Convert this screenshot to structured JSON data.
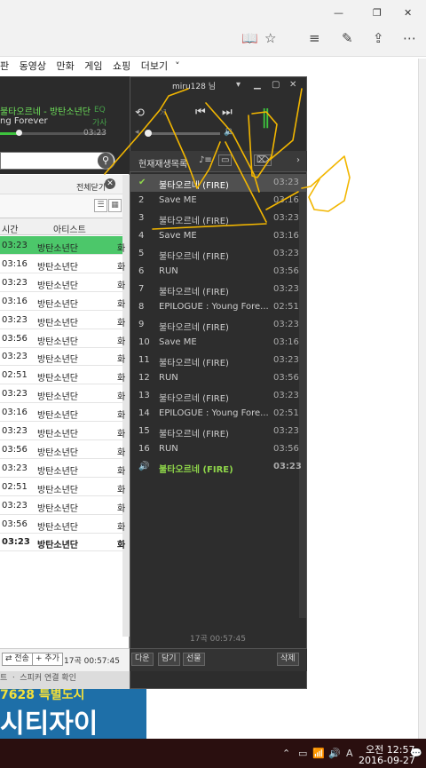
{
  "browser": {
    "window_controls": [
      "—",
      "❐",
      "✕"
    ],
    "toolbar_icons": [
      "reading-view",
      "favorite",
      "hub",
      "notes",
      "share",
      "more"
    ],
    "toolbar_glyphs": [
      "📖",
      "☆",
      "≡",
      "✎",
      "⇪",
      "⋯"
    ]
  },
  "site": {
    "nav": [
      "판",
      "동영상",
      "만화",
      "게임",
      "쇼핑",
      "더보기"
    ],
    "ad_line1": "7628 특별도시",
    "ad_line2": "시티자이"
  },
  "player": {
    "user": "miru128 님",
    "now_playing": {
      "title": "불타오르네 - 방탄소년단",
      "subtitle": "ng Forever",
      "time": "03:23",
      "eq": "EQ",
      "eq_sub": "가사"
    },
    "left_list": {
      "close_all": "전체닫기",
      "columns": {
        "time": "시간",
        "artist": "아티스트"
      },
      "rows": [
        {
          "time": "03:23",
          "artist": "방탄소년단",
          "x": "화",
          "selected": true
        },
        {
          "time": "03:16",
          "artist": "방탄소년단",
          "x": "화"
        },
        {
          "time": "03:23",
          "artist": "방탄소년단",
          "x": "화"
        },
        {
          "time": "03:16",
          "artist": "방탄소년단",
          "x": "화"
        },
        {
          "time": "03:23",
          "artist": "방탄소년단",
          "x": "화"
        },
        {
          "time": "03:56",
          "artist": "방탄소년단",
          "x": "화"
        },
        {
          "time": "03:23",
          "artist": "방탄소년단",
          "x": "화"
        },
        {
          "time": "02:51",
          "artist": "방탄소년단",
          "x": "화"
        },
        {
          "time": "03:23",
          "artist": "방탄소년단",
          "x": "화"
        },
        {
          "time": "03:16",
          "artist": "방탄소년단",
          "x": "화"
        },
        {
          "time": "03:23",
          "artist": "방탄소년단",
          "x": "화"
        },
        {
          "time": "03:56",
          "artist": "방탄소년단",
          "x": "화"
        },
        {
          "time": "03:23",
          "artist": "방탄소년단",
          "x": "화"
        },
        {
          "time": "02:51",
          "artist": "방탄소년단",
          "x": "화"
        },
        {
          "time": "03:23",
          "artist": "방탄소년단",
          "x": "화"
        },
        {
          "time": "03:56",
          "artist": "방탄소년단",
          "x": "화"
        },
        {
          "time": "03:23",
          "artist": "방탄소년단",
          "x": "화",
          "bold": true
        }
      ],
      "footer": {
        "transfer": "전송",
        "add": "추가",
        "summary": "17곡 00:57:45"
      },
      "status": "트 ㆍ 스피커 연결 확인"
    },
    "playlist": {
      "tab": "현재재생목록",
      "rows": [
        {
          "num": "✔",
          "title": "불타오르네 (FIRE)",
          "dur": "03:23",
          "selected": true
        },
        {
          "num": "2",
          "title": "Save ME",
          "dur": "03:16"
        },
        {
          "num": "3",
          "title": "불타오르네 (FIRE)",
          "dur": "03:23"
        },
        {
          "num": "4",
          "title": "Save ME",
          "dur": "03:16"
        },
        {
          "num": "5",
          "title": "불타오르네 (FIRE)",
          "dur": "03:23"
        },
        {
          "num": "6",
          "title": "RUN",
          "dur": "03:56"
        },
        {
          "num": "7",
          "title": "불타오르네 (FIRE)",
          "dur": "03:23"
        },
        {
          "num": "8",
          "title": "EPILOGUE : Young Fore...",
          "dur": "02:51"
        },
        {
          "num": "9",
          "title": "불타오르네 (FIRE)",
          "dur": "03:23"
        },
        {
          "num": "10",
          "title": "Save ME",
          "dur": "03:16"
        },
        {
          "num": "11",
          "title": "불타오르네 (FIRE)",
          "dur": "03:23"
        },
        {
          "num": "12",
          "title": "RUN",
          "dur": "03:56"
        },
        {
          "num": "13",
          "title": "불타오르네 (FIRE)",
          "dur": "03:23"
        },
        {
          "num": "14",
          "title": "EPILOGUE : Young Fore...",
          "dur": "02:51"
        },
        {
          "num": "15",
          "title": "불타오르네 (FIRE)",
          "dur": "03:23"
        },
        {
          "num": "16",
          "title": "RUN",
          "dur": "03:56"
        },
        {
          "num": "🔊",
          "title": "불타오르네 (FIRE)",
          "dur": "03:23",
          "playing": true
        }
      ],
      "count": "17곡 00:57:45",
      "footer": [
        "다운",
        "담기",
        "선물",
        "삭제"
      ]
    }
  },
  "taskbar": {
    "time": "오전 12:57",
    "date": "2016-09-27",
    "tray_icons": [
      "⌃",
      "▭",
      "📶",
      "🔊",
      "A",
      "💬"
    ]
  },
  "colors": {
    "accent_green": "#4cc76a",
    "player_bg": "#2d2d2d",
    "doodle": "#f2b600"
  }
}
